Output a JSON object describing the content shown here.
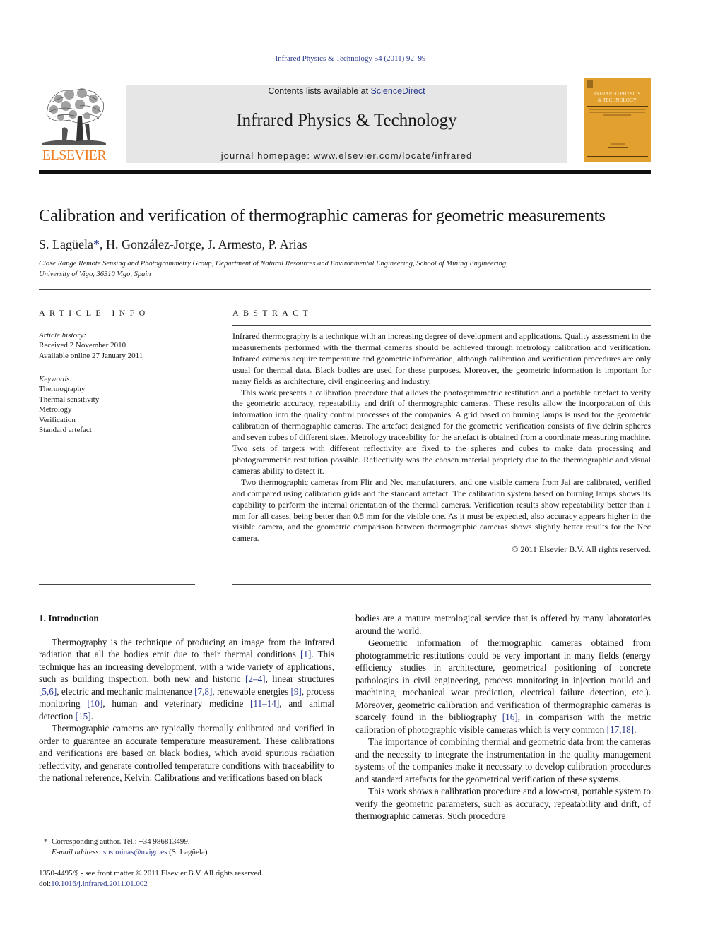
{
  "header": {
    "journal_reference": "Infrared Physics & Technology 54 (2011) 92–99",
    "contents_prefix": "Contents lists available at ",
    "contents_link": "ScienceDirect",
    "journal_title": "Infrared Physics & Technology",
    "homepage": "journal homepage: www.elsevier.com/locate/infrared",
    "publisher_logo_text": "ELSEVIER",
    "cover_title_line1": "INFRARED PHYSICS",
    "cover_title_line2": "& TECHNOLOGY",
    "colors": {
      "link": "#2b3a8c",
      "elsevier_orange": "#f07c1f",
      "cover": "#e2a12f",
      "band": "#e6e6e6"
    }
  },
  "article": {
    "title": "Calibration and verification of thermographic cameras for geometric measurements",
    "authors": [
      {
        "name": "S. Lagüela",
        "corresponding": true
      },
      {
        "name": "H. González-Jorge"
      },
      {
        "name": "J. Armesto"
      },
      {
        "name": "P. Arias"
      }
    ],
    "author_sep": ", ",
    "corresponding_marker": "*",
    "affiliation_line1": "Close Range Remote Sensing and Photogrammetry Group, Department of Natural Resources and Environmental Engineering, School of Mining Engineering,",
    "affiliation_line2": "University of Vigo, 36310 Vigo, Spain"
  },
  "article_info": {
    "heading": "ARTICLE INFO",
    "history_label": "Article history:",
    "received": "Received 2 November 2010",
    "available_online": "Available online 27 January 2011",
    "keywords_label": "Keywords:",
    "keywords": [
      "Thermography",
      "Thermal sensitivity",
      "Metrology",
      "Verification",
      "Standard artefact"
    ]
  },
  "abstract": {
    "heading": "ABSTRACT",
    "paragraphs": [
      "Infrared thermography is a technique with an increasing degree of development and applications. Quality assessment in the measurements performed with the thermal cameras should be achieved through metrology calibration and verification. Infrared cameras acquire temperature and geometric information, although calibration and verification procedures are only usual for thermal data. Black bodies are used for these purposes. Moreover, the geometric information is important for many fields as architecture, civil engineering and industry.",
      "This work presents a calibration procedure that allows the photogrammetric restitution and a portable artefact to verify the geometric accuracy, repeatability and drift of thermographic cameras. These results allow the incorporation of this information into the quality control processes of the companies. A grid based on burning lamps is used for the geometric calibration of thermographic cameras. The artefact designed for the geometric verification consists of five delrin spheres and seven cubes of different sizes. Metrology traceability for the artefact is obtained from a coordinate measuring machine. Two sets of targets with different reflectivity are fixed to the spheres and cubes to make data processing and photogrammetric restitution possible. Reflectivity was the chosen material propriety due to the thermographic and visual cameras ability to detect it.",
      "Two thermographic cameras from Flir and Nec manufacturers, and one visible camera from Jai are calibrated, verified and compared using calibration grids and the standard artefact. The calibration system based on burning lamps shows its capability to perform the internal orientation of the thermal cameras. Verification results show repeatability better than 1 mm for all cases, being better than 0.5 mm for the visible one. As it must be expected, also accuracy appears higher in the visible camera, and the geometric comparison between thermographic cameras shows slightly better results for the Nec camera."
    ],
    "copyright": "© 2011 Elsevier B.V. All rights reserved."
  },
  "body": {
    "section_title": "1. Introduction",
    "left_column": {
      "p1": [
        {
          "t": "Thermography is the technique of producing an image from the infrared radiation that all the bodies emit due to their thermal conditions "
        },
        {
          "c": "[1]"
        },
        {
          "t": ". This technique has an increasing development, with a wide variety of applications, such as building inspection, both new and historic "
        },
        {
          "c": "[2–4]"
        },
        {
          "t": ", linear structures "
        },
        {
          "c": "[5,6]"
        },
        {
          "t": ", electric and mechanic maintenance "
        },
        {
          "c": "[7,8]"
        },
        {
          "t": ", renewable energies "
        },
        {
          "c": "[9]"
        },
        {
          "t": ", process monitoring "
        },
        {
          "c": "[10]"
        },
        {
          "t": ", human and veterinary medicine "
        },
        {
          "c": "[11–14]"
        },
        {
          "t": ", and animal detection "
        },
        {
          "c": "[15]"
        },
        {
          "t": "."
        }
      ],
      "p2": "Thermographic cameras are typically thermally calibrated and verified in order to guarantee an accurate temperature measurement. These calibrations and verifications are based on black bodies, which avoid spurious radiation reflectivity, and generate controlled temperature conditions with traceability to the national reference, Kelvin. Calibrations and verifications based on black"
    },
    "right_column": {
      "p1": "bodies are a mature metrological service that is offered by many laboratories around the world.",
      "p2": [
        {
          "t": "Geometric information of thermographic cameras obtained from photogrammetric restitutions could be very important in many fields (energy efficiency studies in architecture, geometrical positioning of concrete pathologies in civil engineering, process monitoring in injection mould and machining, mechanical wear prediction, electrical failure detection, etc.). Moreover, geometric calibration and verification of thermographic cameras is scarcely found in the bibliography "
        },
        {
          "c": "[16]"
        },
        {
          "t": ", in comparison with the metric calibration of photographic visible cameras which is very common "
        },
        {
          "c": "[17,18]"
        },
        {
          "t": "."
        }
      ],
      "p3": "The importance of combining thermal and geometric data from the cameras and the necessity to integrate the instrumentation in the quality management systems of the companies make it necessary to develop calibration procedures and standard artefacts for the geometrical verification of these systems.",
      "p4": "This work shows a calibration procedure and a low-cost, portable system to verify the geometric parameters, such as accuracy, repeatability and drift, of thermographic cameras. Such procedure"
    }
  },
  "footnotes": {
    "marker": "*",
    "corresponding": "Corresponding author. Tel.: +34 986813499.",
    "email_label": "E-mail address:",
    "email": "susiminas@uvigo.es",
    "email_owner": " (S. Lagüela).",
    "issn_line": "1350-4495/$ - see front matter © 2011 Elsevier B.V. All rights reserved.",
    "doi_prefix": "doi:",
    "doi": "10.1016/j.infrared.2011.01.002"
  }
}
